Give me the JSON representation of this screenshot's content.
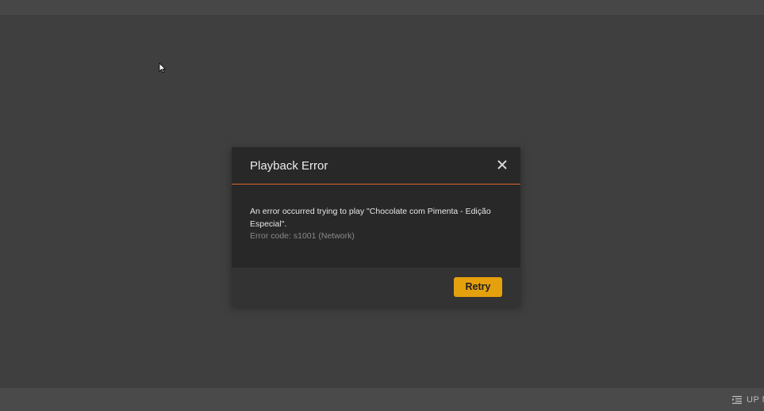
{
  "dialog": {
    "title": "Playback Error",
    "close_icon": "close-icon",
    "message": "An error occurred trying to play \"Chocolate com Pimenta - Edição Especial\".",
    "error_code": "Error code: s1001 (Network)",
    "retry_label": "Retry"
  },
  "bottom_bar": {
    "up_next_label": "UP NEXT",
    "up_next_icon": "queue-list-icon"
  },
  "colors": {
    "background": "#3f3f3f",
    "dialog_background": "#282828",
    "header_divider": "#e5652e",
    "accent": "#e5a00d"
  }
}
